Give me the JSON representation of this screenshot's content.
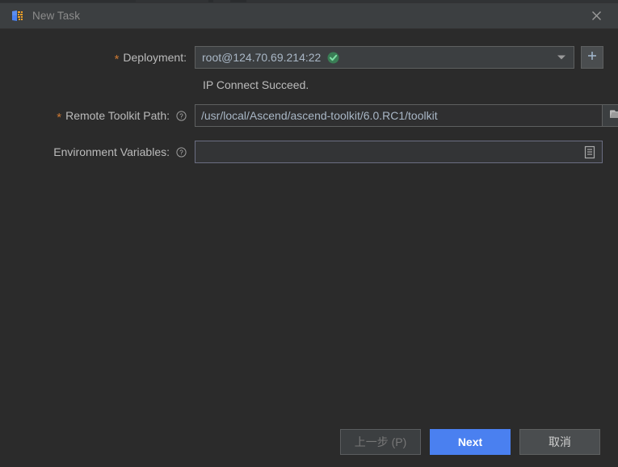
{
  "window": {
    "title": "New Task",
    "app_icon": "pycharm-app-icon",
    "close_icon": "close-icon"
  },
  "form": {
    "deployment": {
      "label": "Deployment:",
      "required_marker": "*",
      "value": "root@124.70.69.214:22",
      "status_badge_icon": "green-check-circle-icon",
      "dropdown_icon": "chevron-down-icon",
      "add_button_icon": "plus-icon",
      "add_button_label": "+"
    },
    "connection_status": {
      "text": "IP Connect Succeed."
    },
    "remote_toolkit_path": {
      "label": "Remote Toolkit Path:",
      "required_marker": "*",
      "help_icon": "question-mark-circle-icon",
      "value": "/usr/local/Ascend/ascend-toolkit/6.0.RC1/toolkit",
      "placeholder": "",
      "browse_icon": "folder-icon"
    },
    "environment_variables": {
      "label": "Environment Variables:",
      "help_icon": "question-mark-circle-icon",
      "value": "",
      "placeholder": "",
      "expand_icon": "expand-editor-icon"
    }
  },
  "footer": {
    "back_label": "上一步 (P)",
    "next_label": "Next",
    "cancel_label": "取消"
  },
  "colors": {
    "accent_blue": "#4a80f0",
    "required_orange": "#cc7832",
    "success_green": "#499c54",
    "titlebar_bg": "#3c3f41",
    "content_bg": "#2b2b2b",
    "field_text": "#a9b7c6"
  }
}
